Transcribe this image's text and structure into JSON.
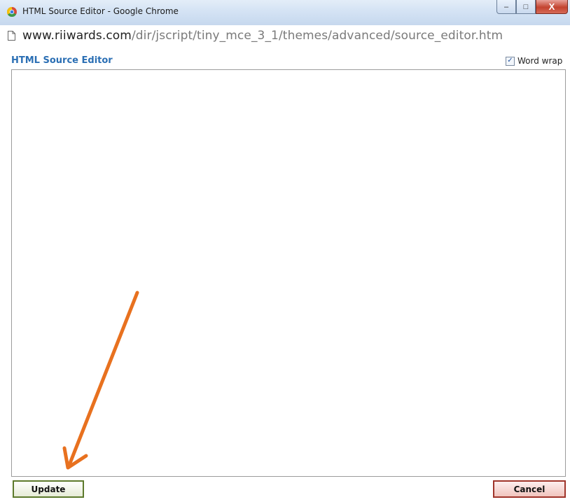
{
  "window": {
    "title": "HTML Source Editor - Google Chrome",
    "controls": {
      "minimize": "–",
      "maximize": "□",
      "close": "X"
    }
  },
  "address": {
    "host": "www.riiwards.com",
    "path": "/dir/jscript/tiny_mce_3_1/themes/advanced/source_editor.htm"
  },
  "editor": {
    "title": "HTML Source Editor",
    "word_wrap_label": "Word wrap",
    "word_wrap_checked": true,
    "content": ""
  },
  "buttons": {
    "update_label": "Update",
    "cancel_label": "Cancel"
  },
  "colors": {
    "annotation_arrow": "#e8711f",
    "title_text": "#2b6fb4",
    "update_border": "#5d7a2c",
    "cancel_border": "#a0342a"
  },
  "icons": [
    "chrome-icon",
    "page-icon",
    "checkbox-checked-icon",
    "annotation-arrow"
  ]
}
